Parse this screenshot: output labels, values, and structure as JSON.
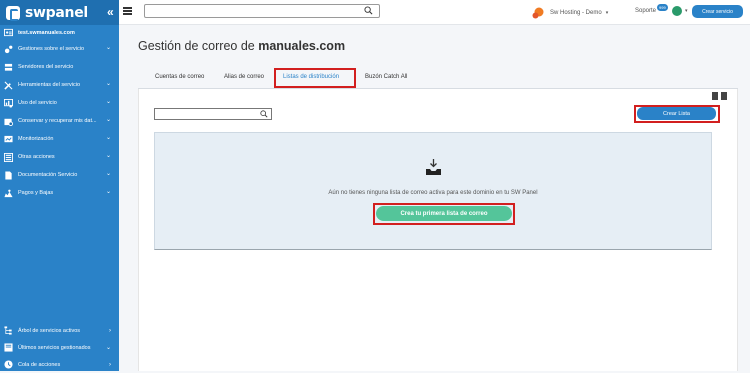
{
  "brand": {
    "name": "swpanel",
    "collapse_glyph": "«"
  },
  "sidebar": {
    "account": "test.swmanuales.com",
    "items": [
      {
        "label": "Gestiones sobre el servicio",
        "icon": "gears-icon",
        "chevron": "⌄"
      },
      {
        "label": "Servidores del servicio",
        "icon": "server-icon",
        "chevron": ""
      },
      {
        "label": "Herramientas del servicio",
        "icon": "tools-icon",
        "chevron": "⌄"
      },
      {
        "label": "Uso del servicio",
        "icon": "usage-icon",
        "chevron": "⌄"
      },
      {
        "label": "Conservar y recuperar mis dat...",
        "icon": "backup-icon",
        "chevron": "⌄"
      },
      {
        "label": "Monitorización",
        "icon": "monitor-icon",
        "chevron": "⌄"
      },
      {
        "label": "Otras acciones",
        "icon": "actions-icon",
        "chevron": "⌄"
      },
      {
        "label": "Documentación Servicio",
        "icon": "doc-icon",
        "chevron": "⌄"
      },
      {
        "label": "Pagos y Bajas",
        "icon": "payments-icon",
        "chevron": "⌄"
      }
    ],
    "bottom": [
      {
        "label": "Árbol de servicios activos",
        "icon": "tree-icon",
        "chevron": "›"
      },
      {
        "label": "Últimos servicios gestionados",
        "icon": "recent-icon",
        "chevron": "⌄"
      },
      {
        "label": "Cola de acciones",
        "icon": "queue-icon",
        "chevron": "›"
      }
    ]
  },
  "topbar": {
    "org": "Sw Hosting - Demo",
    "soporte": "Soporte",
    "soporte_badge": "999",
    "crear_servicio": "Crear servicio",
    "search_placeholder": ""
  },
  "main": {
    "title_prefix": "Gestión de correo de ",
    "title_domain": "manuales.com",
    "tabs": [
      {
        "label": "Cuentas de correo"
      },
      {
        "label": "Alias de correo"
      },
      {
        "label": "Listas de distribución"
      },
      {
        "label": "Buzón Catch All"
      }
    ],
    "active_tab": "Listas de distribución",
    "search_placeholder": "",
    "crear_lista": "Crear Lista",
    "empty_message": "Aún no tienes ninguna lista de correo activa para este dominio en tu SW Panel",
    "cta": "Crea tu primera lista de correo"
  },
  "colors": {
    "sidebar": "#2a82c8",
    "accent": "#2a82c8",
    "cta": "#54c59a",
    "highlight": "#d21f1f",
    "empty_bg": "#e6eef5"
  }
}
